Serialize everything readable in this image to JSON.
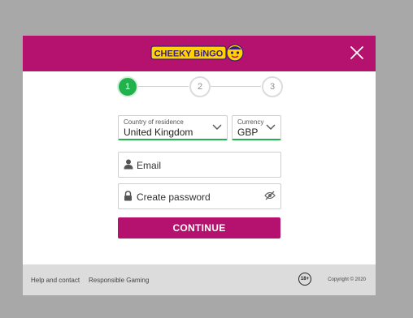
{
  "brand": {
    "logo_text": "CHEEKY BiNGO",
    "color": "#b5116e",
    "accent": "#21b24b"
  },
  "header": {
    "close_icon": "close-icon"
  },
  "steps": {
    "items": [
      "1",
      "2",
      "3"
    ],
    "current": 1
  },
  "form": {
    "country": {
      "label": "Country of residence",
      "value": "United Kingdom"
    },
    "currency": {
      "label": "Currency",
      "value": "GBP"
    },
    "email": {
      "placeholder": "Email"
    },
    "password": {
      "placeholder": "Create password"
    },
    "continue_label": "CONTINUE"
  },
  "footer": {
    "help": "Help and contact",
    "responsible": "Responsible Gaming",
    "age": "18+",
    "copyright": "Copyright © 2020"
  }
}
